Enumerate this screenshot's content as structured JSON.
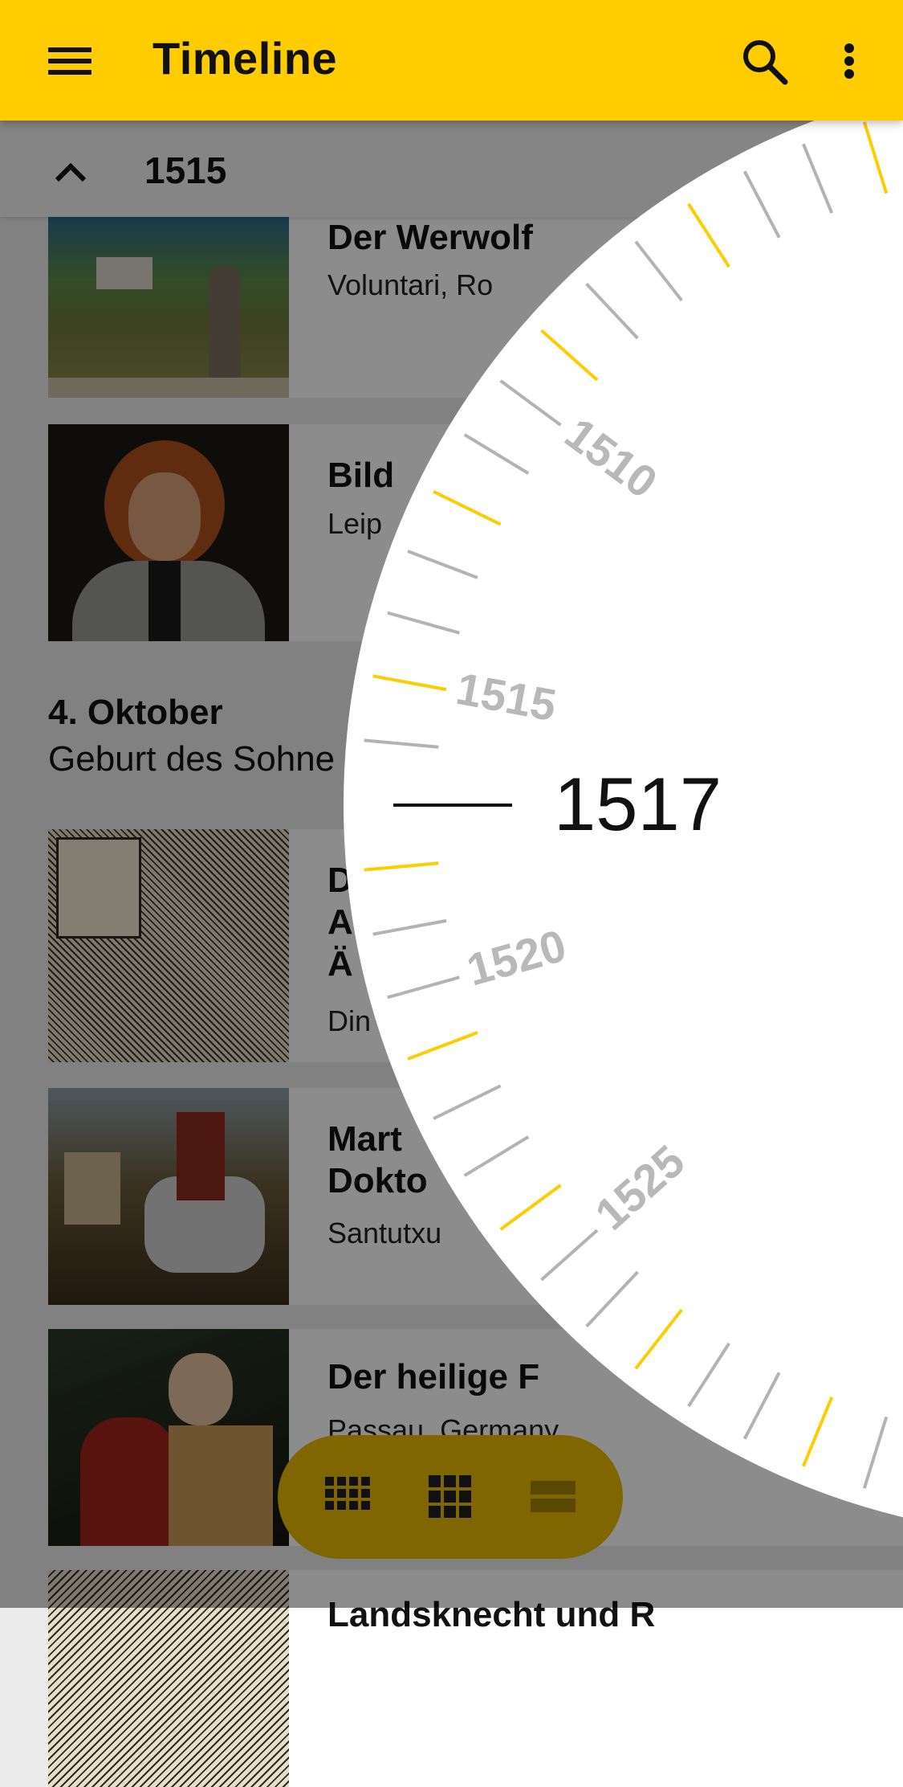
{
  "appbar": {
    "title": "Timeline",
    "menu_icon": "menu-icon",
    "search_icon": "search-icon",
    "more_icon": "more-vert-icon",
    "color": "#ffcc00"
  },
  "subbar": {
    "year": "1515",
    "collapse_icon": "chevron-up-icon"
  },
  "items": [
    {
      "title": "Der Werwolf",
      "subtitle": "Voluntari, Ro"
    },
    {
      "title": "Bild",
      "subtitle": "Leip"
    },
    {
      "title": "D\nA\nÄ",
      "subtitle": "Din"
    },
    {
      "title": "Mart\nDokto",
      "subtitle": "Santutxu"
    },
    {
      "title": "Der heilige F",
      "subtitle": "Passau, Germany"
    },
    {
      "title": "Landsknecht und R",
      "subtitle": ""
    }
  ],
  "day_group": {
    "date": "4. Oktober",
    "text": "Geburt des Sohne"
  },
  "dial": {
    "selected_year": "1517",
    "labels": [
      "1510",
      "1515",
      "1520",
      "1525"
    ],
    "accent": "#ffcc00"
  },
  "view_switch": {
    "options": [
      "small-grid-icon",
      "large-grid-icon",
      "list-icon"
    ],
    "selected": "list-icon"
  }
}
